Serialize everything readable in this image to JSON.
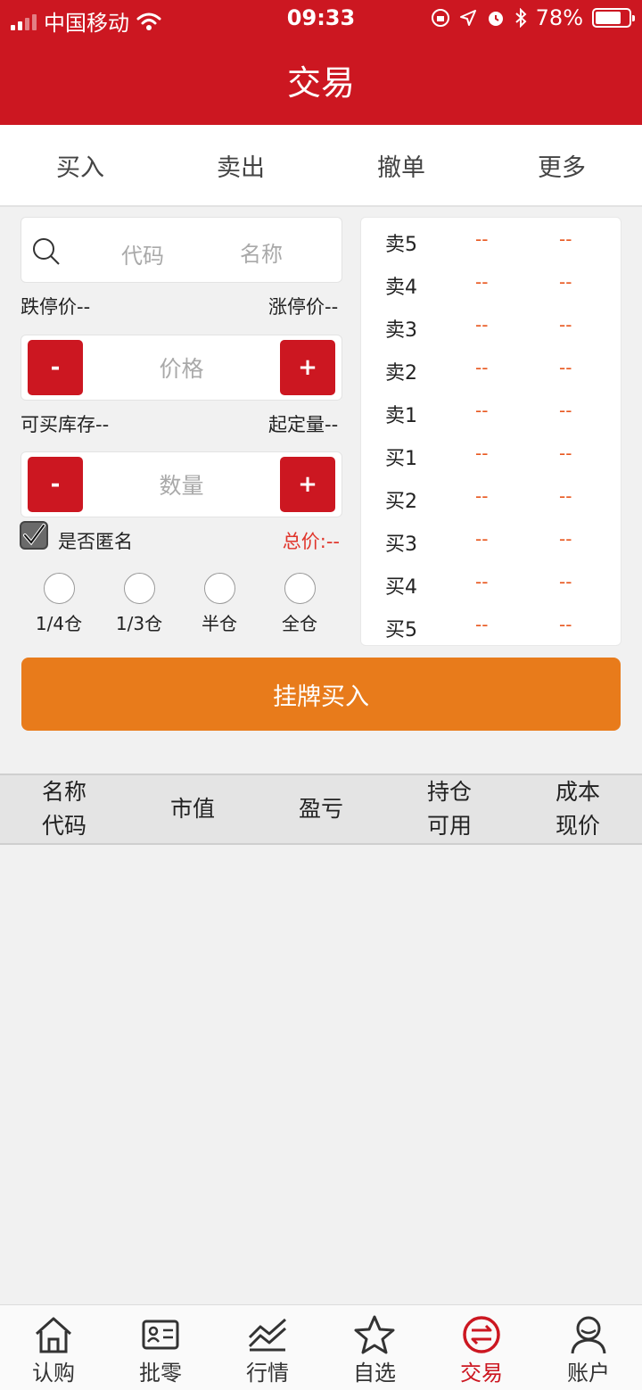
{
  "status_bar": {
    "carrier": "中国移动",
    "time": "09:33",
    "battery": "78%",
    "battery_level": 0.78
  },
  "header": {
    "title": "交易"
  },
  "tabs": [
    {
      "label": "买入",
      "active": true
    },
    {
      "label": "卖出",
      "active": false
    },
    {
      "label": "撤单",
      "active": false
    },
    {
      "label": "更多",
      "active": false
    }
  ],
  "form": {
    "search_code_placeholder": "代码",
    "search_name_placeholder": "名称",
    "limit_down": "跌停价--",
    "limit_up": "涨停价--",
    "price_placeholder": "价格",
    "minus": "-",
    "plus": "+",
    "available_stock": "可买库存--",
    "min_quantity": "起定量--",
    "quantity_placeholder": "数量",
    "anonymous_label": "是否匿名",
    "anonymous_checked": true,
    "total_price": "总价:--",
    "positions": [
      "1/4仓",
      "1/3仓",
      "半仓",
      "全仓"
    ]
  },
  "order_book": [
    {
      "name": "卖5",
      "price": "--",
      "volume": "--"
    },
    {
      "name": "卖4",
      "price": "--",
      "volume": "--"
    },
    {
      "name": "卖3",
      "price": "--",
      "volume": "--"
    },
    {
      "name": "卖2",
      "price": "--",
      "volume": "--"
    },
    {
      "name": "卖1",
      "price": "--",
      "volume": "--"
    },
    {
      "name": "买1",
      "price": "--",
      "volume": "--"
    },
    {
      "name": "买2",
      "price": "--",
      "volume": "--"
    },
    {
      "name": "买3",
      "price": "--",
      "volume": "--"
    },
    {
      "name": "买4",
      "price": "--",
      "volume": "--"
    },
    {
      "name": "买5",
      "price": "--",
      "volume": "--"
    }
  ],
  "submit_label": "挂牌买入",
  "holdings_header": [
    [
      "名称",
      "代码"
    ],
    [
      "市值"
    ],
    [
      "盈亏"
    ],
    [
      "持仓",
      "可用"
    ],
    [
      "成本",
      "现价"
    ]
  ],
  "bottom_nav": [
    {
      "label": "认购",
      "icon": "home-icon",
      "active": false
    },
    {
      "label": "批零",
      "icon": "id-card-icon",
      "active": false
    },
    {
      "label": "行情",
      "icon": "chart-icon",
      "active": false
    },
    {
      "label": "自选",
      "icon": "star-icon",
      "active": false
    },
    {
      "label": "交易",
      "icon": "exchange-icon",
      "active": true
    },
    {
      "label": "账户",
      "icon": "user-icon",
      "active": false
    }
  ],
  "colors": {
    "brand_red": "#cc1721",
    "submit_orange": "#e87b1b",
    "quote_orange": "#e8571f"
  }
}
